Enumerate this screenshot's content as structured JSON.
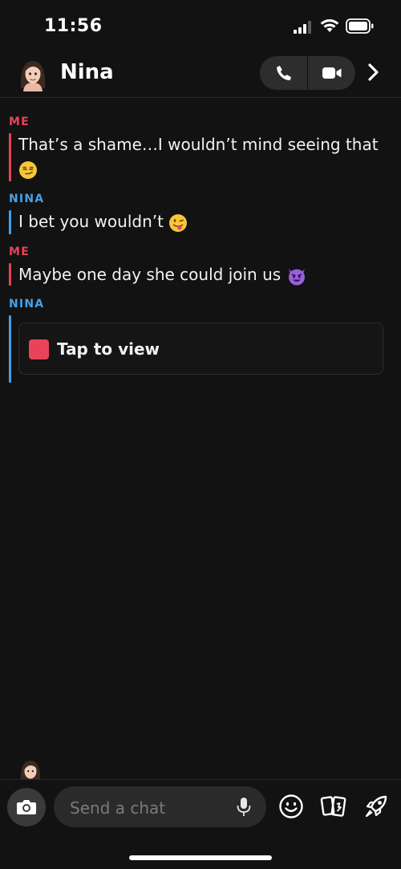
{
  "status_bar": {
    "time": "11:56"
  },
  "header": {
    "contact_name": "Nina"
  },
  "messages": [
    {
      "sender": "ME",
      "text": "That’s a shame…I wouldn’t mind seeing that",
      "emoji": "smirk"
    },
    {
      "sender": "NINA",
      "text": "I bet you wouldn’t",
      "emoji": "tongue-out"
    },
    {
      "sender": "ME",
      "text": "Maybe one day she could join us",
      "emoji": "smiling-devil"
    },
    {
      "sender": "NINA",
      "snap_label": "Tap to view"
    }
  ],
  "composer": {
    "placeholder": "Send a chat"
  },
  "colors": {
    "me": "#e84359",
    "nina": "#47a0e8",
    "background": "#121212"
  }
}
